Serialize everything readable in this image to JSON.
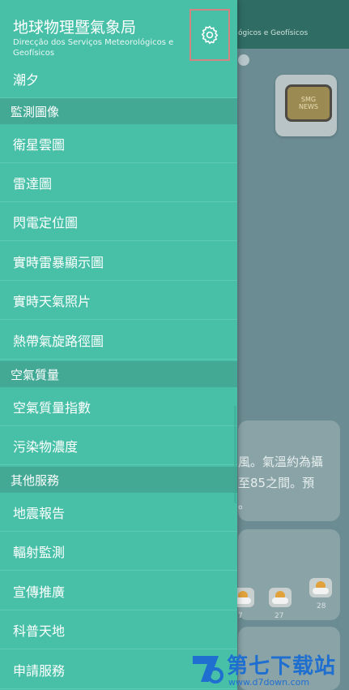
{
  "drawer": {
    "org_name_zh": "地球物理暨氣象局",
    "org_name_pt": "Direcção dos Serviços Meteorológicos e Geofísicos",
    "top_item": "潮夕",
    "sections": [
      {
        "title": "監測圖像",
        "items": [
          "衛星雲圖",
          "雷達圖",
          "閃電定位圖",
          "實時雷暴顯示圖",
          "實時天氣照片",
          "熱帶氣旋路徑圖"
        ]
      },
      {
        "title": "空氣質量",
        "items": [
          "空氣質量指數",
          "污染物濃度"
        ]
      },
      {
        "title": "其他服務",
        "items": [
          "地震報告",
          "輻射監測",
          "宣傳推廣",
          "科普天地",
          "申請服務"
        ]
      }
    ]
  },
  "background": {
    "topbar_text": "ógicos e Geofísicos",
    "news_badge": [
      "SMG",
      "NEWS"
    ],
    "card_lines": [
      "風。氣溫約為攝",
      "至85之間。預",
      "。"
    ],
    "forecast_temps": [
      "7",
      "27",
      "28"
    ]
  },
  "watermark": {
    "text": "第七下载站",
    "url": "www.d7down.com"
  },
  "icons": {
    "settings": "gear-icon"
  },
  "colors": {
    "drawer": "#48c0a8",
    "section_header": "#43a995",
    "settings_highlight": "#d48383"
  }
}
